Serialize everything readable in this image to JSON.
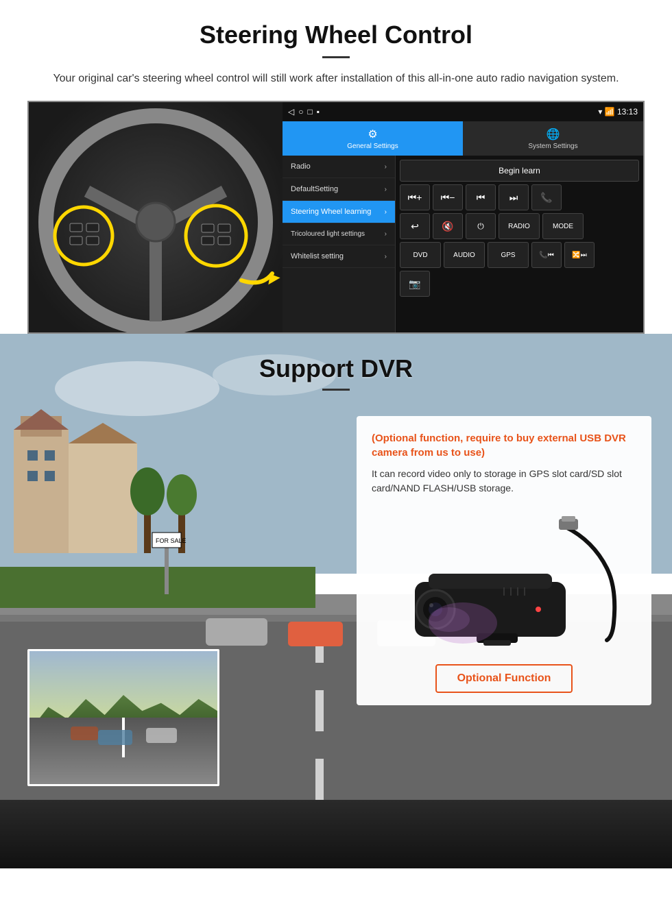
{
  "steering": {
    "title": "Steering Wheel Control",
    "description": "Your original car's steering wheel control will still work after installation of this all-in-one auto radio navigation system.",
    "status_time": "13:13",
    "tabs": [
      {
        "label": "General Settings",
        "icon": "⚙"
      },
      {
        "label": "System Settings",
        "icon": "🌐"
      }
    ],
    "menu_items": [
      {
        "label": "Radio",
        "active": false
      },
      {
        "label": "DefaultSetting",
        "active": false
      },
      {
        "label": "Steering Wheel learning",
        "active": true
      },
      {
        "label": "Tricoloured light settings",
        "active": false
      },
      {
        "label": "Whitelist setting",
        "active": false
      }
    ],
    "begin_learn_label": "Begin learn",
    "control_buttons": [
      [
        "⏮+",
        "⏮-",
        "⏮◀",
        "⏭▶",
        "📞"
      ],
      [
        "↩",
        "🔇",
        "⏻",
        "RADIO",
        "MODE"
      ],
      [
        "DVD",
        "AUDIO",
        "GPS",
        "📞⏮",
        "🔀⏭"
      ],
      [
        "📷"
      ]
    ]
  },
  "dvr": {
    "title": "Support DVR",
    "optional_text": "(Optional function, require to buy external USB DVR camera from us to use)",
    "description": "It can record video only to storage in GPS slot card/SD slot card/NAND FLASH/USB storage.",
    "optional_button_label": "Optional Function"
  }
}
